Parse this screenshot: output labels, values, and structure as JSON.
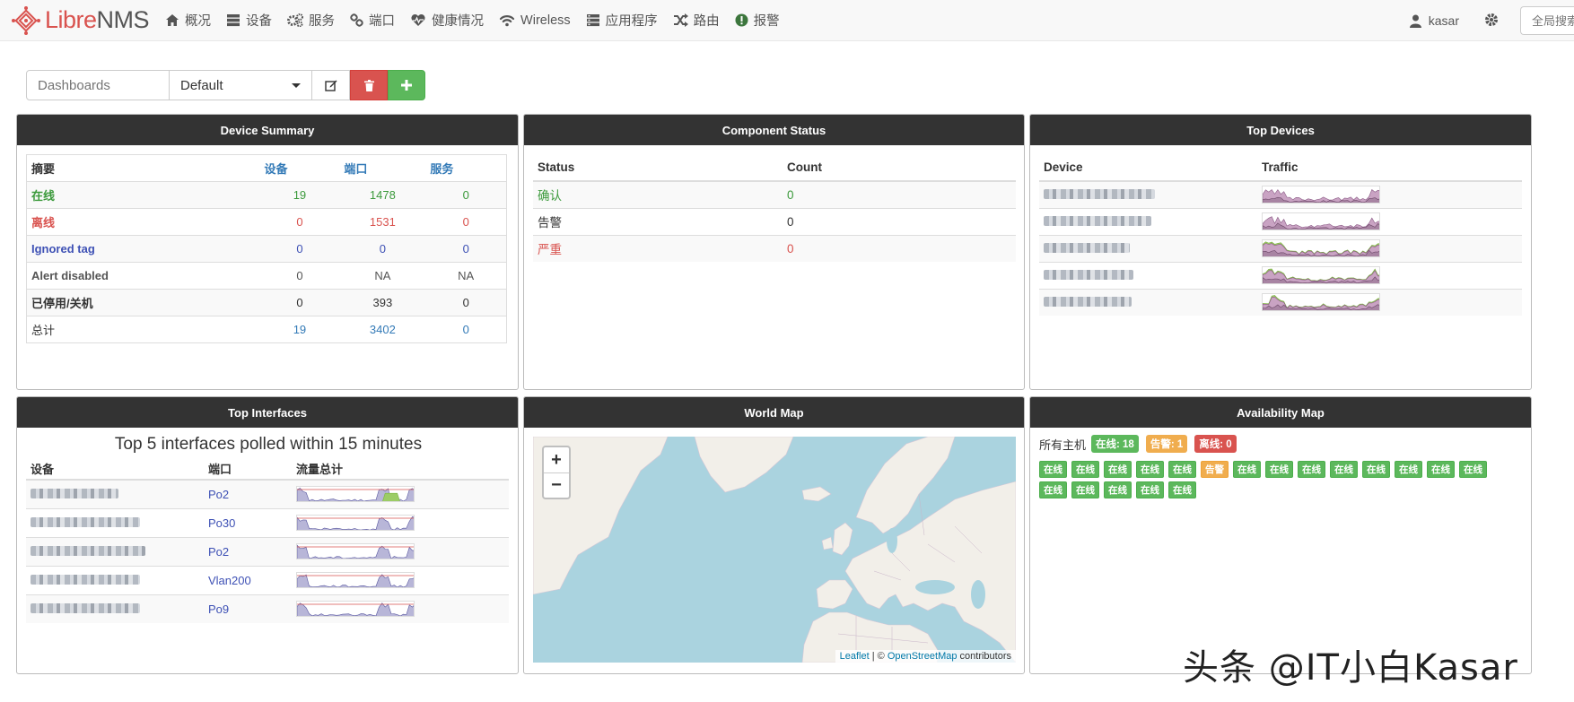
{
  "brand": {
    "libre": "Libre",
    "nms": "NMS"
  },
  "nav": [
    {
      "label": "概况",
      "icon": "home-icon"
    },
    {
      "label": "设备",
      "icon": "server-icon"
    },
    {
      "label": "服务",
      "icon": "cogs-icon"
    },
    {
      "label": "端口",
      "icon": "link-icon"
    },
    {
      "label": "健康情况",
      "icon": "heartbeat-icon"
    },
    {
      "label": "Wireless",
      "icon": "wifi-icon"
    },
    {
      "label": "应用程序",
      "icon": "tasks-icon"
    },
    {
      "label": "路由",
      "icon": "random-icon"
    },
    {
      "label": "报警",
      "icon": "exclamation-circle-icon"
    }
  ],
  "user": {
    "name": "kasar"
  },
  "search": {
    "placeholder": "全局搜索"
  },
  "toolbar": {
    "dashboards_placeholder": "Dashboards",
    "selected_dashboard": "Default"
  },
  "device_summary": {
    "title": "Device Summary",
    "headers": [
      "摘要",
      "设备",
      "端口",
      "服务"
    ],
    "rows": [
      {
        "label": "在线",
        "devices": "19",
        "ports": "1478",
        "services": "0"
      },
      {
        "label": "离线",
        "devices": "0",
        "ports": "1531",
        "services": "0"
      },
      {
        "label": "Ignored tag",
        "devices": "0",
        "ports": "0",
        "services": "0"
      },
      {
        "label": "Alert disabled",
        "devices": "0",
        "ports": "NA",
        "services": "NA"
      },
      {
        "label": "已停用/关机",
        "devices": "0",
        "ports": "393",
        "services": "0"
      },
      {
        "label": "总计",
        "devices": "19",
        "ports": "3402",
        "services": "0"
      }
    ]
  },
  "component_status": {
    "title": "Component Status",
    "headers": [
      "Status",
      "Count"
    ],
    "rows": [
      {
        "status": "确认",
        "count": "0"
      },
      {
        "status": "告警",
        "count": "0"
      },
      {
        "status": "严重",
        "count": "0"
      }
    ]
  },
  "top_devices": {
    "title": "Top Devices",
    "headers": [
      "Device",
      "Traffic"
    ]
  },
  "top_interfaces": {
    "title": "Top Interfaces",
    "subtitle": "Top 5 interfaces polled within 15 minutes",
    "headers": [
      "设备",
      "端口",
      "流量总计"
    ],
    "ports": [
      "Po2",
      "Po30",
      "Po2",
      "Vlan200",
      "Po9"
    ]
  },
  "world_map": {
    "title": "World Map",
    "zoom_in": "+",
    "zoom_out": "−",
    "attrib_leaflet": "Leaflet",
    "attrib_sep": " | © ",
    "attrib_osm": "OpenStreetMap",
    "attrib_contrib": " contributors"
  },
  "availability": {
    "title": "Availability Map",
    "all_hosts": "所有主机",
    "online": "在线: 18",
    "warning": "告警: 1",
    "offline": "离线: 0",
    "tiles": [
      "在线",
      "在线",
      "在线",
      "在线",
      "在线",
      "告警",
      "在线",
      "在线",
      "在线",
      "在线",
      "在线",
      "在线",
      "在线",
      "在线",
      "在线",
      "在线",
      "在线",
      "在线",
      "在线"
    ]
  },
  "watermark": "头条 @IT小白Kasar",
  "colors": {
    "online": "#5cb85c",
    "warning": "#f0ad4e",
    "offline": "#d9534f",
    "header": "#333333"
  }
}
